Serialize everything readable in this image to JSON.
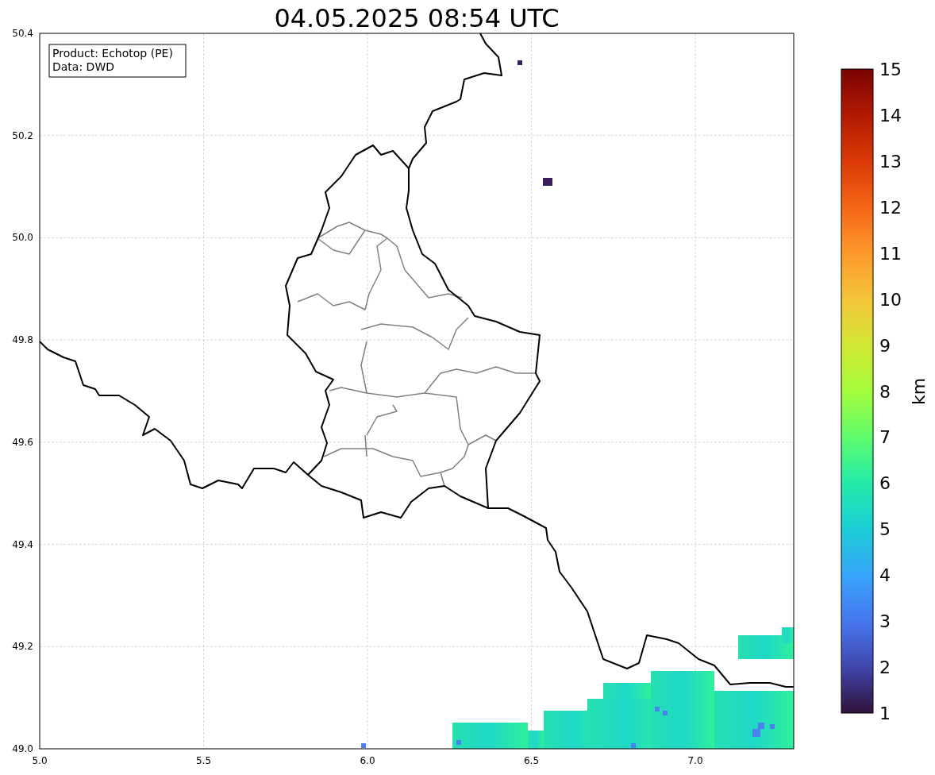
{
  "title": "04.05.2025 08:54 UTC",
  "legend": [
    "Product: Echotop (PE)",
    "Data: DWD"
  ],
  "map": {
    "xtick_labels": [
      "5.0",
      "5.5",
      "6.0",
      "6.5",
      "7.0"
    ],
    "ytick_labels": [
      "50.4",
      "50.2",
      "50.0",
      "49.8",
      "49.6",
      "49.4",
      "49.2",
      "49.0"
    ]
  },
  "colorbar": {
    "label": "km",
    "tick_labels": [
      "15",
      "14",
      "13",
      "12",
      "11",
      "10",
      "9",
      "8",
      "7",
      "6",
      "5",
      "4",
      "3",
      "2",
      "1"
    ]
  }
}
